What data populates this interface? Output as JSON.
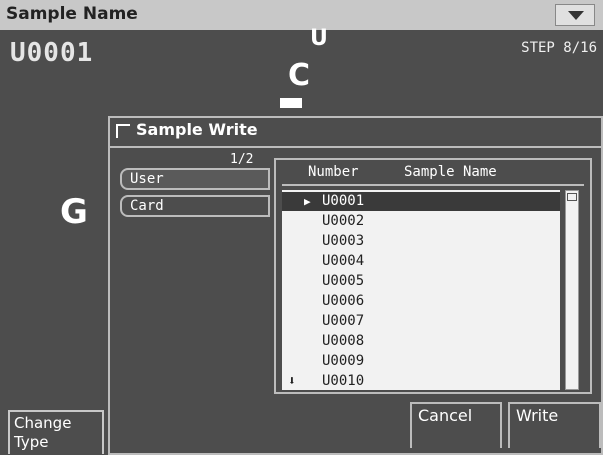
{
  "screen": {
    "title": "Sample Name",
    "sample_id": "U0001",
    "step": "STEP 8/16",
    "change_type": "Change\nType"
  },
  "dialog": {
    "title": "Sample Write",
    "page": "1/2",
    "tabs": [
      "User",
      "Card"
    ],
    "columns": {
      "number": "Number",
      "name": "Sample Name"
    },
    "rows": [
      "U0001",
      "U0002",
      "U0003",
      "U0004",
      "U0005",
      "U0006",
      "U0007",
      "U0008",
      "U0009",
      "U0010"
    ],
    "selected_index": 0,
    "cancel_label": "Cancel",
    "write_label": "Write"
  }
}
